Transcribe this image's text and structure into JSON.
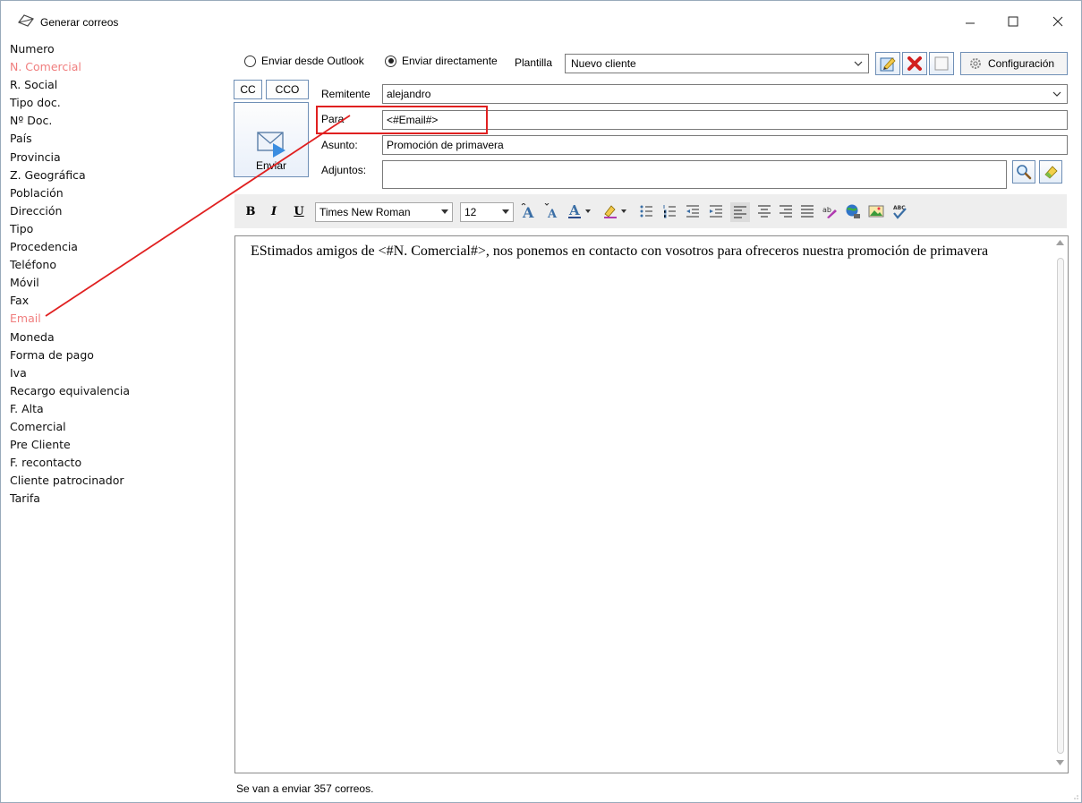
{
  "window": {
    "title": "Generar correos"
  },
  "fields": [
    "Numero",
    "N. Comercial",
    "R. Social",
    "Tipo doc.",
    "Nº Doc.",
    "País",
    "Provincia",
    "Z. Geográfica",
    "Población",
    "Dirección",
    "Tipo",
    "Procedencia",
    "Teléfono",
    "Móvil",
    "Fax",
    "Email",
    "Moneda",
    "Forma de pago",
    "Iva",
    "Recargo equivalencia",
    "F. Alta",
    "Comercial",
    "Pre Cliente",
    "F. recontacto",
    "Cliente patrocinador",
    "Tarifa"
  ],
  "send_mode": {
    "outlook_label": "Enviar desde Outlook",
    "direct_label": "Enviar directamente",
    "selected": "direct"
  },
  "template": {
    "label": "Plantilla",
    "value": "Nuevo cliente"
  },
  "toolbar": {
    "config_label": "Configuración"
  },
  "buttons": {
    "cc": "CC",
    "cco": "CCO",
    "send": "Enviar"
  },
  "form": {
    "sender_label": "Remitente",
    "sender_value": "alejandro",
    "to_label": "Para",
    "to_value": "<#Email#>",
    "subject_label": "Asunto:",
    "subject_value": "Promoción de primavera",
    "attach_label": "Adjuntos:",
    "attach_value": ""
  },
  "format": {
    "font": "Times New Roman",
    "size": "12"
  },
  "editor": {
    "body": "EStimados amigos de <#N. Comercial#>, nos ponemos en contacto con vosotros para ofreceros nuestra promoción de primavera"
  },
  "status": "Se van a enviar 357 correos.",
  "colors": {
    "highlight": "#f07e7e",
    "annotation": "#e02020",
    "button_border": "#6f8fb6"
  }
}
